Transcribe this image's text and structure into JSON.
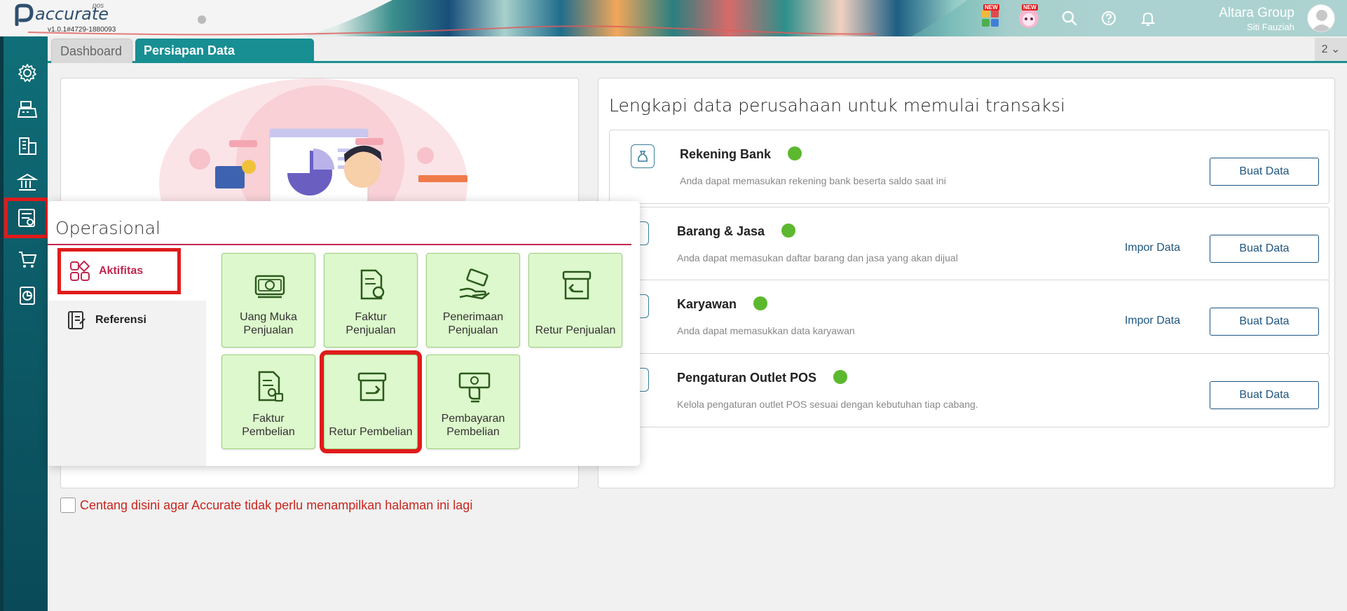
{
  "header": {
    "logo_text": "accurate",
    "logo_suffix": "pos",
    "version": "v1.0.1#4729-1880093",
    "new_badge_1": "NEW",
    "new_badge_2": "NEW",
    "company_name": "Altara Group",
    "user_name": "Siti Fauziah"
  },
  "tabs": {
    "dashboard": "Dashboard",
    "persiapan": "Persiapan Data Perusahaan",
    "count": "2"
  },
  "right_panel": {
    "title": "Lengkapi data perusahaan untuk memulai transaksi",
    "items": [
      {
        "title": "Rekening Bank",
        "desc": "Anda dapat memasukan rekening bank beserta saldo saat ini",
        "impor": "",
        "buat": "Buat Data"
      },
      {
        "title": "Barang & Jasa",
        "desc": "Anda dapat memasukan daftar barang dan jasa yang akan dijual",
        "impor": "Impor Data",
        "buat": "Buat Data"
      },
      {
        "title": "Karyawan",
        "desc": "Anda dapat memasukkan data karyawan",
        "impor": "Impor Data",
        "buat": "Buat Data"
      },
      {
        "title": "Pengaturan Outlet POS",
        "desc": "Kelola pengaturan outlet POS sesuai dengan kebutuhan tiap cabang.",
        "impor": "",
        "buat": "Buat Data"
      }
    ]
  },
  "footer": {
    "checkbox_label": "Centang disini agar Accurate tidak perlu menampilkan halaman ini lagi"
  },
  "popup": {
    "title": "Operasional",
    "tabs": {
      "aktifitas": "Aktifitas",
      "referensi": "Referensi"
    },
    "tiles": [
      {
        "label_1": "Uang Muka",
        "label_2": "Penjualan"
      },
      {
        "label_1": "Faktur",
        "label_2": "Penjualan"
      },
      {
        "label_1": "Penerimaan",
        "label_2": "Penjualan"
      },
      {
        "label_1": "Retur Penjualan",
        "label_2": ""
      },
      {
        "label_1": "Faktur",
        "label_2": "Pembelian"
      },
      {
        "label_1": "Retur Pembelian",
        "label_2": ""
      },
      {
        "label_1": "Pembayaran",
        "label_2": "Pembelian"
      }
    ]
  },
  "colors": {
    "teal": "#178f93",
    "sidebar": "#0d5d6a",
    "highlight": "#e01b1b",
    "tile_bg": "#ddf8cc",
    "brand_blue": "#1e5580",
    "check_green": "#5cb82e"
  }
}
